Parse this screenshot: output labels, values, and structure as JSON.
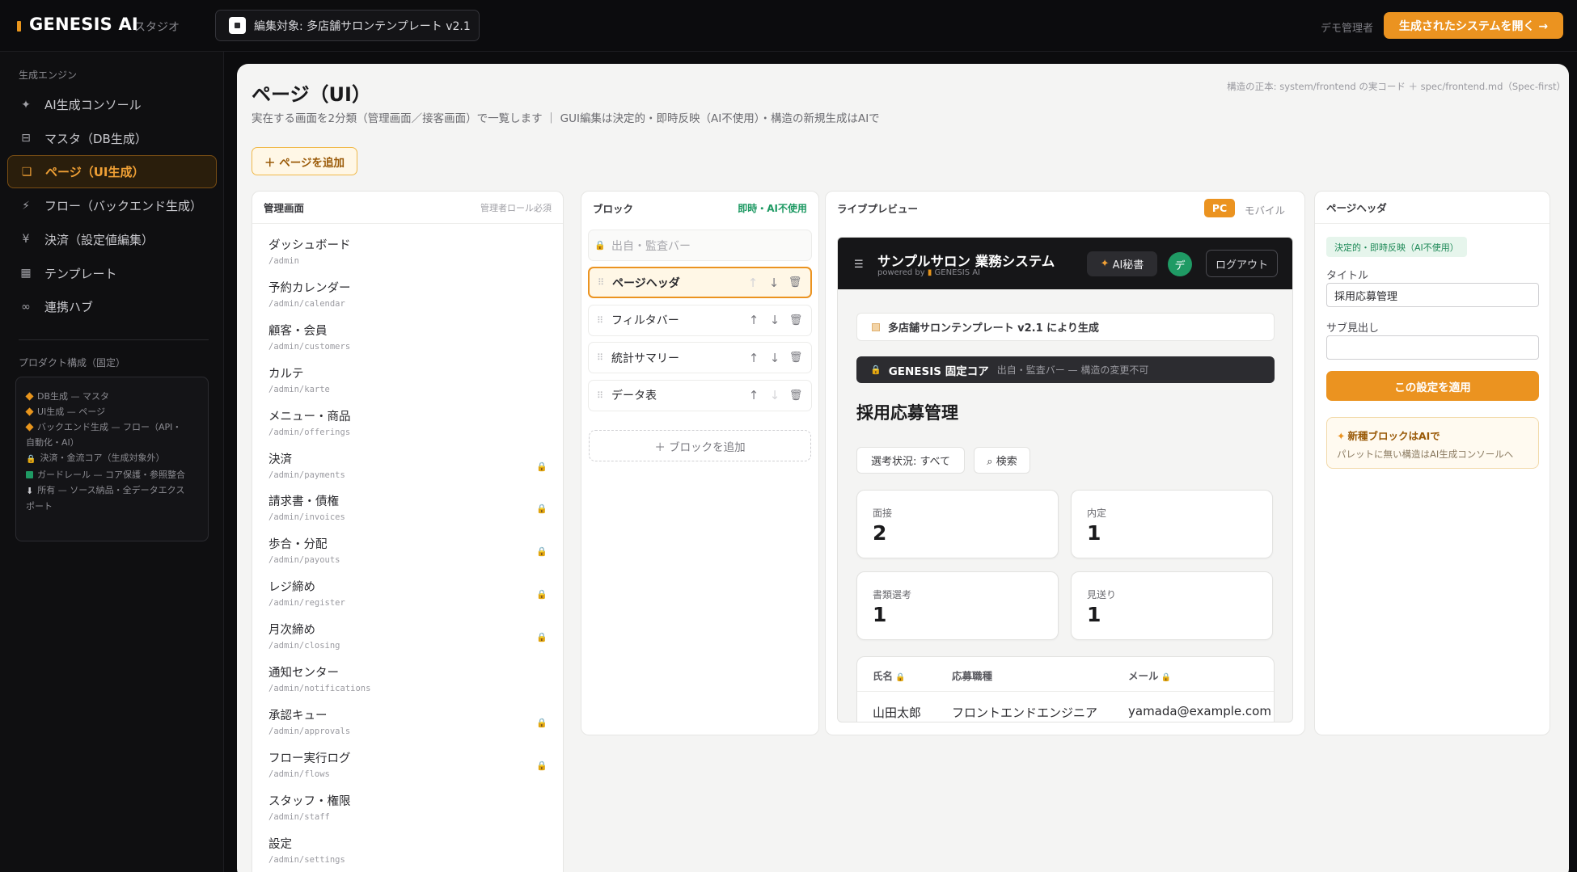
{
  "topbar": {
    "brand": "GENESIS AI",
    "brand_sub": "スタジオ",
    "edit_target": "編集対象: 多店舗サロンテンプレート v2.1",
    "user": "デモ管理者",
    "open_system": "生成されたシステムを開く →"
  },
  "sidebar": {
    "section_engine": "生成エンジン",
    "items": [
      {
        "icon": "✦",
        "label": "AI生成コンソール"
      },
      {
        "icon": "⊟",
        "label": "マスタ（DB生成）"
      },
      {
        "icon": "❏",
        "label": "ページ（UI生成）"
      },
      {
        "icon": "⚡",
        "label": "フロー（バックエンド生成）"
      },
      {
        "icon": "¥",
        "label": "決済（設定値編集）"
      },
      {
        "icon": "▦",
        "label": "テンプレート"
      },
      {
        "icon": "∞",
        "label": "連携ハブ"
      }
    ],
    "active_index": 2,
    "section_product": "プロダクト構成（固定）",
    "product_lines": [
      "DB生成 — マスタ",
      "UI生成 — ページ",
      "バックエンド生成 — フロー（API・",
      "自動化・AI）",
      "決済・金流コア（生成対象外）",
      "ガードレール — コア保護・参照整合",
      "所有 — ソース納品・全データエクス",
      "ポート"
    ]
  },
  "main": {
    "title": "ページ（UI）",
    "subtitle": "実在する画面を2分類（管理画面／接客画面）で一覧します ｜ GUI編集は決定的・即時反映（AI不使用）・構造の新規生成はAIで",
    "source_note": "構造の正本: system/frontend の実コード ＋ spec/frontend.md（Spec-first）",
    "add_page": "＋ ページを追加"
  },
  "admin_panel": {
    "title": "管理画面",
    "note": "管理者ロール必須",
    "pages": [
      {
        "name": "ダッシュボード",
        "path": "/admin",
        "locked": false
      },
      {
        "name": "予約カレンダー",
        "path": "/admin/calendar",
        "locked": false
      },
      {
        "name": "顧客・会員",
        "path": "/admin/customers",
        "locked": false
      },
      {
        "name": "カルテ",
        "path": "/admin/karte",
        "locked": false
      },
      {
        "name": "メニュー・商品",
        "path": "/admin/offerings",
        "locked": false
      },
      {
        "name": "決済",
        "path": "/admin/payments",
        "locked": true
      },
      {
        "name": "請求書・債権",
        "path": "/admin/invoices",
        "locked": true
      },
      {
        "name": "歩合・分配",
        "path": "/admin/payouts",
        "locked": true
      },
      {
        "name": "レジ締め",
        "path": "/admin/register",
        "locked": true
      },
      {
        "name": "月次締め",
        "path": "/admin/closing",
        "locked": true
      },
      {
        "name": "通知センター",
        "path": "/admin/notifications",
        "locked": false
      },
      {
        "name": "承認キュー",
        "path": "/admin/approvals",
        "locked": true
      },
      {
        "name": "フロー実行ログ",
        "path": "/admin/flows",
        "locked": true
      },
      {
        "name": "スタッフ・権限",
        "path": "/admin/staff",
        "locked": false
      },
      {
        "name": "設定",
        "path": "/admin/settings",
        "locked": false
      }
    ]
  },
  "blocks_panel": {
    "title": "ブロック",
    "note": "即時・AI不使用",
    "locked_block": "出自・監査バー",
    "blocks": [
      "ページヘッダ",
      "フィルタバー",
      "統計サマリー",
      "データ表"
    ],
    "selected_index": 0,
    "add_block": "＋ ブロックを追加"
  },
  "preview": {
    "title": "ライブプレビュー",
    "pc": "PC",
    "mobile": "モバイル",
    "app_title": "サンプルサロン 業務システム",
    "powered_by": "powered by",
    "powered_brand": "GENESIS AI",
    "ai_button": "AI秘書",
    "avatar": "デ",
    "logout": "ログアウト",
    "generated_note": "多店舗サロンテンプレート v2.1 により生成",
    "core_name": "GENESIS 固定コア",
    "core_note": "出自・監査バー — 構造の変更不可",
    "page_title": "採用応募管理",
    "filter_status": "選考状況: すべて",
    "filter_search": "⌕ 検索",
    "stats": [
      {
        "label": "面接",
        "value": "2"
      },
      {
        "label": "内定",
        "value": "1"
      },
      {
        "label": "書類選考",
        "value": "1"
      },
      {
        "label": "見送り",
        "value": "1"
      }
    ],
    "table": {
      "headers": [
        "氏名",
        "応募職種",
        "メール"
      ],
      "row": [
        "山田太郎",
        "フロントエンドエンジニア",
        "yamada@example.com"
      ]
    }
  },
  "settings_panel": {
    "title": "ページヘッダ",
    "badge": "決定的・即時反映（AI不使用）",
    "title_label": "タイトル",
    "title_value": "採用応募管理",
    "subtitle_label": "サブ見出し",
    "subtitle_value": "",
    "apply": "この設定を適用",
    "note_title": "新種ブロックはAIで",
    "note_body": "パレットに無い構造はAI生成コンソールへ"
  }
}
